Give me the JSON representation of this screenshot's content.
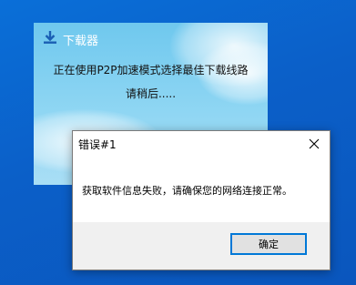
{
  "downloader": {
    "title": "下载器",
    "icon": "download-icon",
    "status_text": "正在使用P2P加速模式选择最佳下载线路",
    "wait_text": "请稍后....."
  },
  "error_dialog": {
    "title": "错误#1",
    "close_icon": "close-icon",
    "message": "获取软件信息失败，请确保您的网络连接正常。",
    "ok_label": "确定"
  },
  "colors": {
    "desktop": "#0a63cf",
    "accent_border": "#0078d7",
    "dialog_footer": "#f0f0f0"
  }
}
